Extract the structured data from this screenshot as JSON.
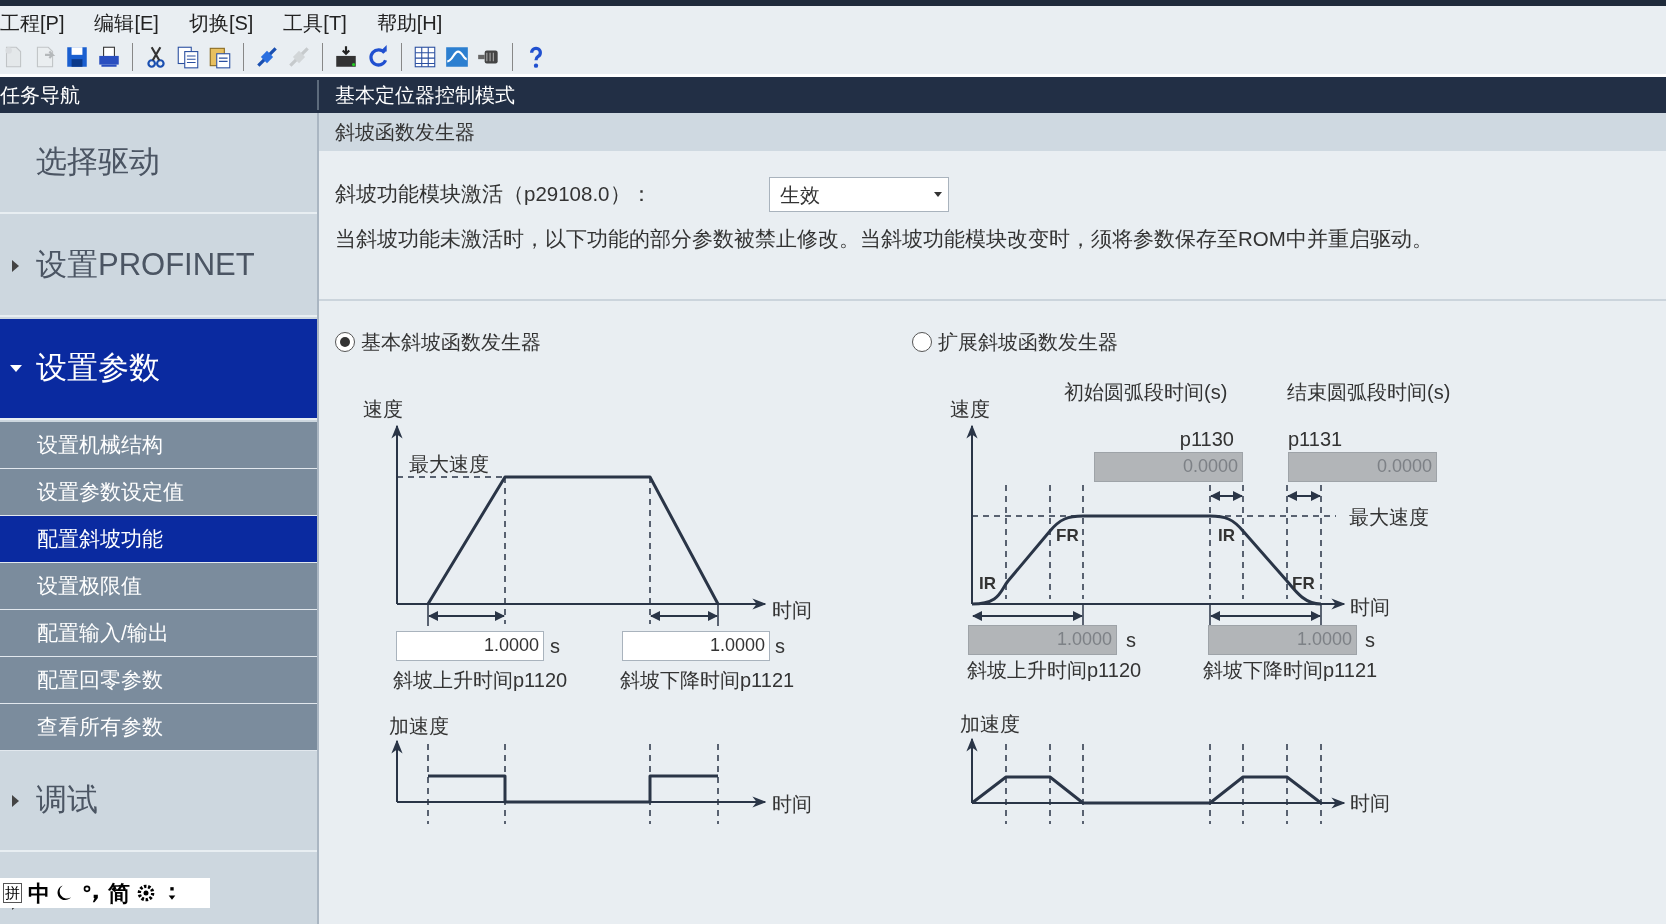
{
  "menu": [
    {
      "label": "工程[P]"
    },
    {
      "label": "编辑[E]"
    },
    {
      "label": "切换[S]"
    },
    {
      "label": "工具[T]"
    },
    {
      "label": "帮助[H]"
    }
  ],
  "toolbar": [
    {
      "kind": "new",
      "disabled": true
    },
    {
      "kind": "open",
      "disabled": true
    },
    {
      "kind": "save",
      "disabled": false
    },
    {
      "kind": "print",
      "disabled": false
    },
    {
      "kind": "separator"
    },
    {
      "kind": "cut",
      "disabled": false
    },
    {
      "kind": "copy",
      "disabled": false
    },
    {
      "kind": "paste",
      "disabled": false
    },
    {
      "kind": "separator"
    },
    {
      "kind": "connect",
      "disabled": false
    },
    {
      "kind": "disconnect",
      "disabled": true
    },
    {
      "kind": "separator"
    },
    {
      "kind": "rom",
      "disabled": false
    },
    {
      "kind": "refresh",
      "disabled": false
    },
    {
      "kind": "separator"
    },
    {
      "kind": "table",
      "disabled": false
    },
    {
      "kind": "wave",
      "disabled": false
    },
    {
      "kind": "motor",
      "disabled": false
    },
    {
      "kind": "separator"
    },
    {
      "kind": "help",
      "disabled": false
    }
  ],
  "sidebar": {
    "title": "任务导航",
    "items": [
      {
        "label": "选择驱动",
        "kind": "link",
        "selected": false
      },
      {
        "label": "设置PROFINET",
        "kind": "group",
        "expanded": false,
        "selected": false
      },
      {
        "label": "设置参数",
        "kind": "group",
        "expanded": true,
        "selected": true,
        "children": [
          {
            "label": "设置机械结构",
            "selected": false
          },
          {
            "label": "设置参数设定值",
            "selected": false
          },
          {
            "label": "配置斜坡功能",
            "selected": true
          },
          {
            "label": "设置极限值",
            "selected": false
          },
          {
            "label": "配置输入/输出",
            "selected": false
          },
          {
            "label": "配置回零参数",
            "selected": false
          },
          {
            "label": "查看所有参数",
            "selected": false
          }
        ]
      },
      {
        "label": "调试",
        "kind": "group",
        "expanded": false,
        "selected": false
      },
      {
        "kind": "group",
        "expanded": false,
        "selected": false
      }
    ]
  },
  "header": {
    "title": "基本定位器控制模式"
  },
  "panel": {
    "title": "斜坡函数发生器",
    "activation": {
      "label": "斜坡功能模块激活（p29108.0）：",
      "value": "生效"
    },
    "note": "当斜坡功能未激活时，以下功能的部分参数被禁止修改。当斜坡功能模块改变时，须将参数保存至ROM中并重启驱动。"
  },
  "modes": [
    {
      "kind": "basic",
      "label": "基本斜坡函数发生器",
      "selected": true,
      "speed_axis": "速度",
      "time_axis": "时间",
      "max_speed": "最大速度",
      "accel_axis": "加速度",
      "accel_time_axis": "时间",
      "fields": [
        {
          "value": "1.0000",
          "unit": "s",
          "label": "斜坡上升时间p1120",
          "disabled": false
        },
        {
          "value": "1.0000",
          "unit": "s",
          "label": "斜坡下降时间p1121",
          "disabled": false
        }
      ]
    },
    {
      "kind": "extended",
      "label": "扩展斜坡函数发生器",
      "selected": false,
      "speed_axis": "速度",
      "time_axis": "时间",
      "max_speed": "最大速度",
      "accel_axis": "加速度",
      "accel_time_axis": "时间",
      "rounding": [
        {
          "title": "初始圆弧段时间(s)",
          "param": "p1130",
          "value": "0.0000",
          "disabled": true
        },
        {
          "title": "结束圆弧段时间(s)",
          "param": "p1131",
          "value": "0.0000",
          "disabled": true
        }
      ],
      "curve_marks": [
        "IR",
        "FR",
        "IR",
        "FR"
      ],
      "fields": [
        {
          "value": "1.0000",
          "unit": "s",
          "label": "斜坡上升时间p1120",
          "disabled": true
        },
        {
          "value": "1.0000",
          "unit": "s",
          "label": "斜坡下降时间p1121",
          "disabled": true
        }
      ]
    }
  ],
  "ime_bar": {
    "items": [
      {
        "kind": "boxed",
        "label": "拼"
      },
      {
        "kind": "text",
        "label": "中"
      },
      {
        "kind": "moon"
      },
      {
        "kind": "punct"
      },
      {
        "kind": "text",
        "label": "简"
      },
      {
        "kind": "gear"
      },
      {
        "kind": "more"
      }
    ]
  }
}
